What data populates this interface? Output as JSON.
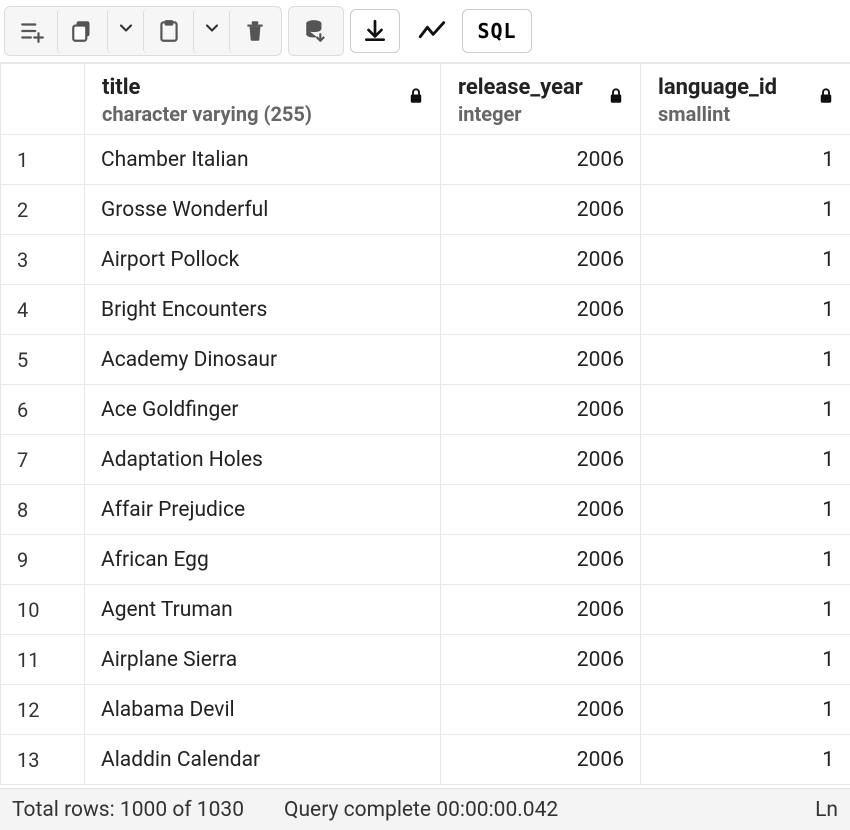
{
  "toolbar": {
    "addrows_label": "Add rows",
    "copy_label": "Copy",
    "paste_label": "Paste",
    "delete_label": "Delete",
    "saverun_label": "Save/Run",
    "download_label": "Download",
    "chart_label": "Chart",
    "sql_label": "SQL"
  },
  "columns": [
    {
      "name": "title",
      "type": "character varying (255)",
      "locked": true
    },
    {
      "name": "release_year",
      "type": "integer",
      "locked": true
    },
    {
      "name": "language_id",
      "type": "smallint",
      "locked": true
    }
  ],
  "rows": [
    {
      "n": 1,
      "title": "Chamber Italian",
      "release_year": 2006,
      "language_id": 1
    },
    {
      "n": 2,
      "title": "Grosse Wonderful",
      "release_year": 2006,
      "language_id": 1
    },
    {
      "n": 3,
      "title": "Airport Pollock",
      "release_year": 2006,
      "language_id": 1
    },
    {
      "n": 4,
      "title": "Bright Encounters",
      "release_year": 2006,
      "language_id": 1
    },
    {
      "n": 5,
      "title": "Academy Dinosaur",
      "release_year": 2006,
      "language_id": 1
    },
    {
      "n": 6,
      "title": "Ace Goldfinger",
      "release_year": 2006,
      "language_id": 1
    },
    {
      "n": 7,
      "title": "Adaptation Holes",
      "release_year": 2006,
      "language_id": 1
    },
    {
      "n": 8,
      "title": "Affair Prejudice",
      "release_year": 2006,
      "language_id": 1
    },
    {
      "n": 9,
      "title": "African Egg",
      "release_year": 2006,
      "language_id": 1
    },
    {
      "n": 10,
      "title": "Agent Truman",
      "release_year": 2006,
      "language_id": 1
    },
    {
      "n": 11,
      "title": "Airplane Sierra",
      "release_year": 2006,
      "language_id": 1
    },
    {
      "n": 12,
      "title": "Alabama Devil",
      "release_year": 2006,
      "language_id": 1
    },
    {
      "n": 13,
      "title": "Aladdin Calendar",
      "release_year": 2006,
      "language_id": 1
    }
  ],
  "status": {
    "total_pre": "Total rows: ",
    "total_val": "1000 of 1030",
    "query_pre": "Query complete ",
    "query_time": "00:00:00.042",
    "ln": "Ln "
  }
}
